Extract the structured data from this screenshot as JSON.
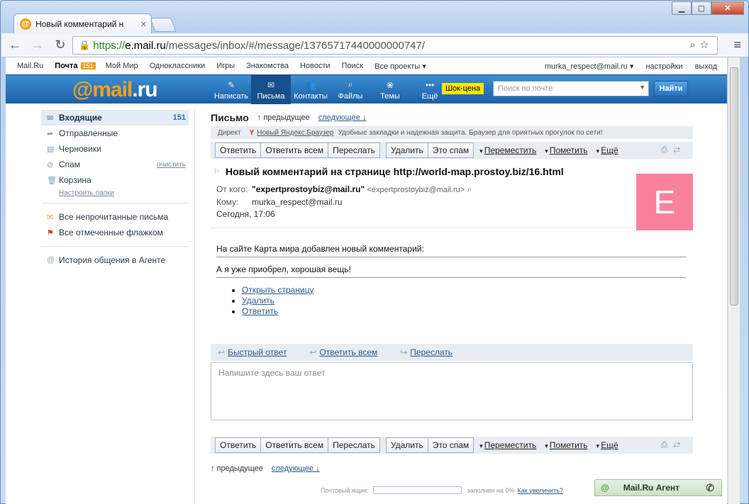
{
  "browser": {
    "tab_title": "Новый комментарий н",
    "url_scheme": "https://",
    "url_host": "e.mail.ru",
    "url_path": "/messages/inbox/#/message/13765717440000000747/"
  },
  "portal": {
    "items": [
      "Mail.Ru",
      "Почта",
      "Мой Мир",
      "Одноклассники",
      "Игры",
      "Знакомства",
      "Новости",
      "Поиск",
      "Все проекты ▾"
    ],
    "mail_count": "151",
    "user": "murka_respect@mail.ru ▾",
    "settings": "настройки",
    "logout": "выход"
  },
  "header": {
    "logo_at": "@mail",
    "logo_ru": ".ru",
    "nav": [
      {
        "label": "Написать",
        "icon": "pencil-icon",
        "glyph": "✎"
      },
      {
        "label": "Письма",
        "icon": "envelope-icon",
        "glyph": "✉"
      },
      {
        "label": "Контакты",
        "icon": "contacts-icon",
        "glyph": "👥"
      },
      {
        "label": "Файлы",
        "icon": "clip-icon",
        "glyph": "⌕"
      },
      {
        "label": "Темы",
        "icon": "palette-icon",
        "glyph": "❀"
      },
      {
        "label": "Ещё",
        "icon": "more-icon",
        "glyph": "•••"
      }
    ],
    "promo": "Шок-цена",
    "search_placeholder": "Поиск по почте",
    "search_button": "Найти"
  },
  "sidebar": {
    "folders": [
      {
        "label": "Входящие",
        "count": "151",
        "glyph": "✉"
      },
      {
        "label": "Отправленные",
        "glyph": "➦"
      },
      {
        "label": "Черновики",
        "glyph": "▤"
      },
      {
        "label": "Спам",
        "glyph": "⊘",
        "action": "очистить"
      },
      {
        "label": "Корзина",
        "glyph": "🗑"
      }
    ],
    "setup_folders": "Настроить папки",
    "filters": [
      "Все непрочитанные письма",
      "Все отмеченные флажком"
    ],
    "agent_history": "История общения в Агенте"
  },
  "message": {
    "page_title": "Письмо",
    "prev": "↑ предыдущее",
    "next": "следующее ↓",
    "direct": {
      "label": "Директ",
      "link": "Новый Яндекс.Браузер",
      "text": "Удобные закладки и надежная защита. Браузер для приятных прогулок по сети!"
    },
    "actions": {
      "reply": "Ответить",
      "reply_all": "Ответить всем",
      "forward": "Переслать",
      "delete": "Удалить",
      "spam": "Это спам",
      "move": "Переместить",
      "mark": "Пометить",
      "more": "Ещё"
    },
    "subject": "Новый комментарий на странице http://world-map.prostoy.biz/16.html",
    "from_label": "От кого:",
    "from_name": "\"expertprostoybiz@mail.ru\"",
    "from_email": "<expertprostoybiz@mail.ru>",
    "to_label": "Кому:",
    "to": "murka_respect@mail.ru",
    "date": "Сегодня, 17:06",
    "avatar_letter": "E",
    "avatar_color": "#f8829e",
    "body_line1": "На сайте Карта мира добавлен новый комментарий:",
    "body_line2": "А я уже приобрел, хорошая вещь!",
    "links": [
      "Открыть страницу",
      "Удалить",
      "Ответить"
    ]
  },
  "quick_reply": {
    "quick": "Быстрый ответ",
    "reply_all": "Ответить всем",
    "forward": "Переслать",
    "placeholder": "Напишите здесь ваш ответ"
  },
  "footer": {
    "quota_label": "Почтовый ящик:",
    "quota_fill_percent": 0,
    "quota_text": "заполнен на 0%",
    "quota_link": "Как увеличить?",
    "agent": "Mail.Ru Агент"
  }
}
